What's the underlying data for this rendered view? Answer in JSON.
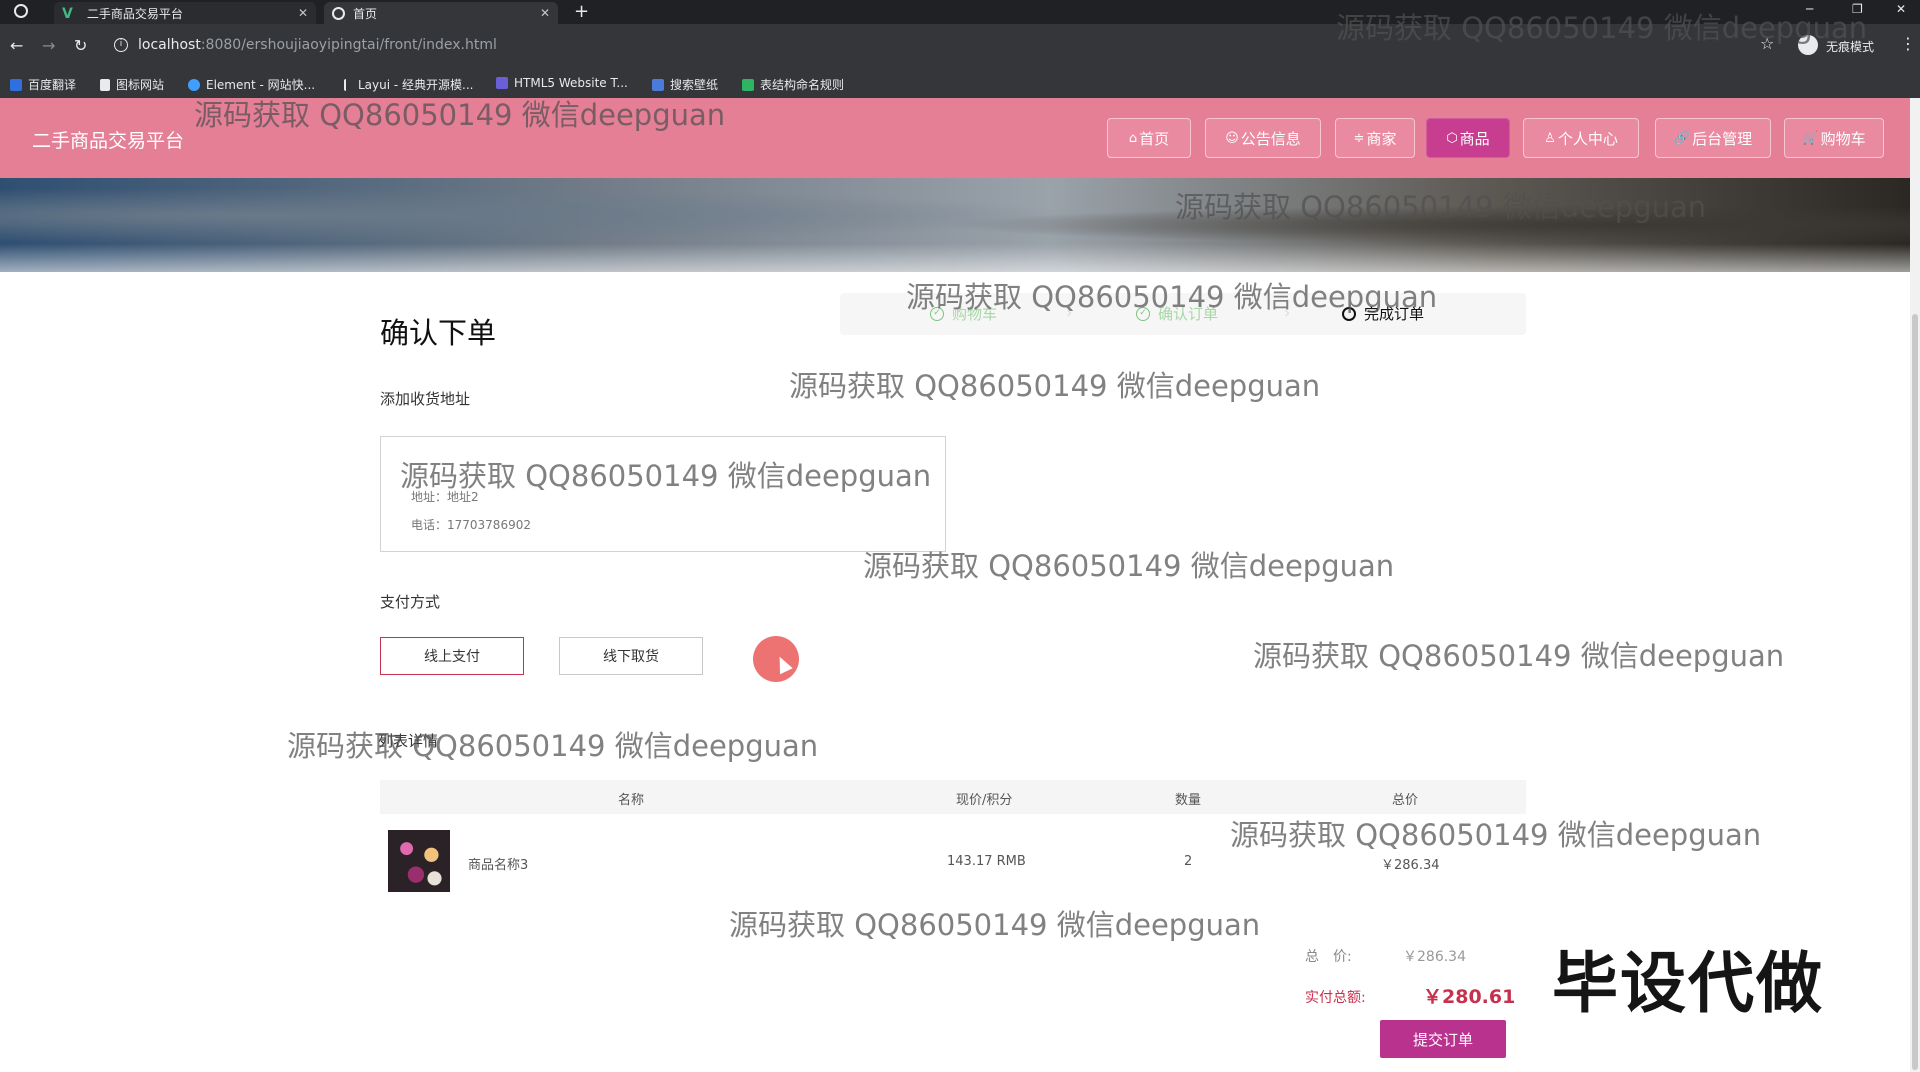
{
  "browser": {
    "tabs": [
      {
        "title": "二手商品交易平台",
        "active": false
      },
      {
        "title": "首页",
        "active": true
      }
    ],
    "url_host": "localhost",
    "url_rest": ":8080/ershoujiaoyipingtai/front/index.html",
    "incognito_label": "无痕模式",
    "bookmarks": [
      "百度翻译",
      "图标网站",
      "Element - 网站快...",
      "Layui - 经典开源模...",
      "HTML5 Website T...",
      "搜索壁纸",
      "表结构命名规则"
    ]
  },
  "site": {
    "brand": "二手商品交易平台",
    "nav": [
      {
        "label": "首页",
        "icon": "⌂"
      },
      {
        "label": "公告信息",
        "icon": "☺"
      },
      {
        "label": "商家",
        "icon": "≑"
      },
      {
        "label": "商品",
        "icon": "⬡"
      },
      {
        "label": "个人中心",
        "icon": "♙"
      },
      {
        "label": "后台管理",
        "icon": "🔗"
      },
      {
        "label": "购物车",
        "icon": "🛒"
      }
    ],
    "active_nav": "商品"
  },
  "order": {
    "title": "确认下单",
    "steps": [
      {
        "label": "购物车",
        "done": true
      },
      {
        "label": "确认订单",
        "done": true
      },
      {
        "label": "完成订单",
        "done": false
      }
    ],
    "address_section": "添加收货地址",
    "address": {
      "line1": "地址：地址2",
      "line2": "电话：17703786902"
    },
    "payment_section": "支付方式",
    "payment_options": [
      "线上支付",
      "线下取货"
    ],
    "selected_payment": "线上支付",
    "list_section": "列表详情",
    "table": {
      "headers": [
        "名称",
        "现价/积分",
        "数量",
        "总价"
      ],
      "rows": [
        {
          "name": "商品名称3",
          "price": "143.17 RMB",
          "qty": "2",
          "total": "￥286.34"
        }
      ]
    },
    "summary": {
      "total_label": "总　价:",
      "total_value": "￥286.34",
      "paid_label": "实付总额:",
      "paid_value": "￥280.61"
    },
    "submit_label": "提交订单"
  },
  "watermarks": {
    "text": "源码获取 QQ86050149 微信deepguan",
    "corner": "毕设代做"
  },
  "colors": {
    "header_bg": "#e57f96",
    "active_nav_bg": "#c73d8f",
    "submit_bg": "#b9338e",
    "price_accent": "#c7304e",
    "step_done": "#7fc47f"
  }
}
